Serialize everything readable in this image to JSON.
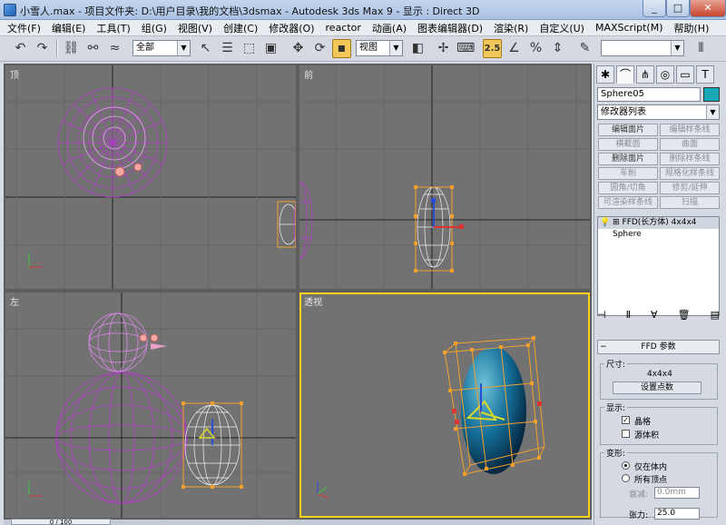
{
  "window": {
    "title": "小雪人.max    - 项目文件夹: D:\\用户目录\\我的文档\\3dsmax    - Autodesk 3ds Max 9    - 显示 : Direct 3D",
    "min": "_",
    "max": "□",
    "close": "✕"
  },
  "menu": [
    "文件(F)",
    "编辑(E)",
    "工具(T)",
    "组(G)",
    "视图(V)",
    "创建(C)",
    "修改器(O)",
    "reactor",
    "动画(A)",
    "图表编辑器(D)",
    "渲染(R)",
    "自定义(U)",
    "MAXScript(M)",
    "帮助(H)"
  ],
  "toolbar": {
    "selection_filter": "全部",
    "ref_coord": "视图",
    "snap_value": "2.5",
    "named_selection": ""
  },
  "viewports": {
    "top": "顶",
    "front": "前",
    "left": "左",
    "perspective": "透视"
  },
  "panel": {
    "object_name": "Sphere05",
    "object_color": "#1aa7b3",
    "modifier_list": "修改器列表",
    "buttons": [
      {
        "label": "编辑面片",
        "dim": false
      },
      {
        "label": "编辑样条线",
        "dim": true
      },
      {
        "label": "横截面",
        "dim": true
      },
      {
        "label": "曲面",
        "dim": true
      },
      {
        "label": "删除面片",
        "dim": false
      },
      {
        "label": "删除样条线",
        "dim": true
      },
      {
        "label": "车削",
        "dim": true
      },
      {
        "label": "规格化样条线",
        "dim": true
      },
      {
        "label": "圆角/切角",
        "dim": true
      },
      {
        "label": "修剪/延伸",
        "dim": true
      },
      {
        "label": "可渲染样条线",
        "dim": true
      },
      {
        "label": "扫描",
        "dim": true
      }
    ],
    "stack": {
      "modifier": "FFD(长方体) 4x4x4",
      "base": "Sphere"
    },
    "rollout_title": "FFD 参数",
    "dimensions_group": "尺寸:",
    "dimensions_value": "4x4x4",
    "set_points": "设置点数",
    "display_group": "显示:",
    "lattice_label": "晶格",
    "lattice_checked": true,
    "source_volume_label": "源体积",
    "source_volume_checked": false,
    "deform_group": "变形:",
    "inside_label": "仅在体内",
    "all_vertices_label": "所有顶点",
    "falloff_label": "衰减:",
    "falloff_value": "0.0mm",
    "tension_label": "张力:",
    "tension_value": "25.0"
  },
  "timeline": {
    "frame": "0 / 100"
  }
}
